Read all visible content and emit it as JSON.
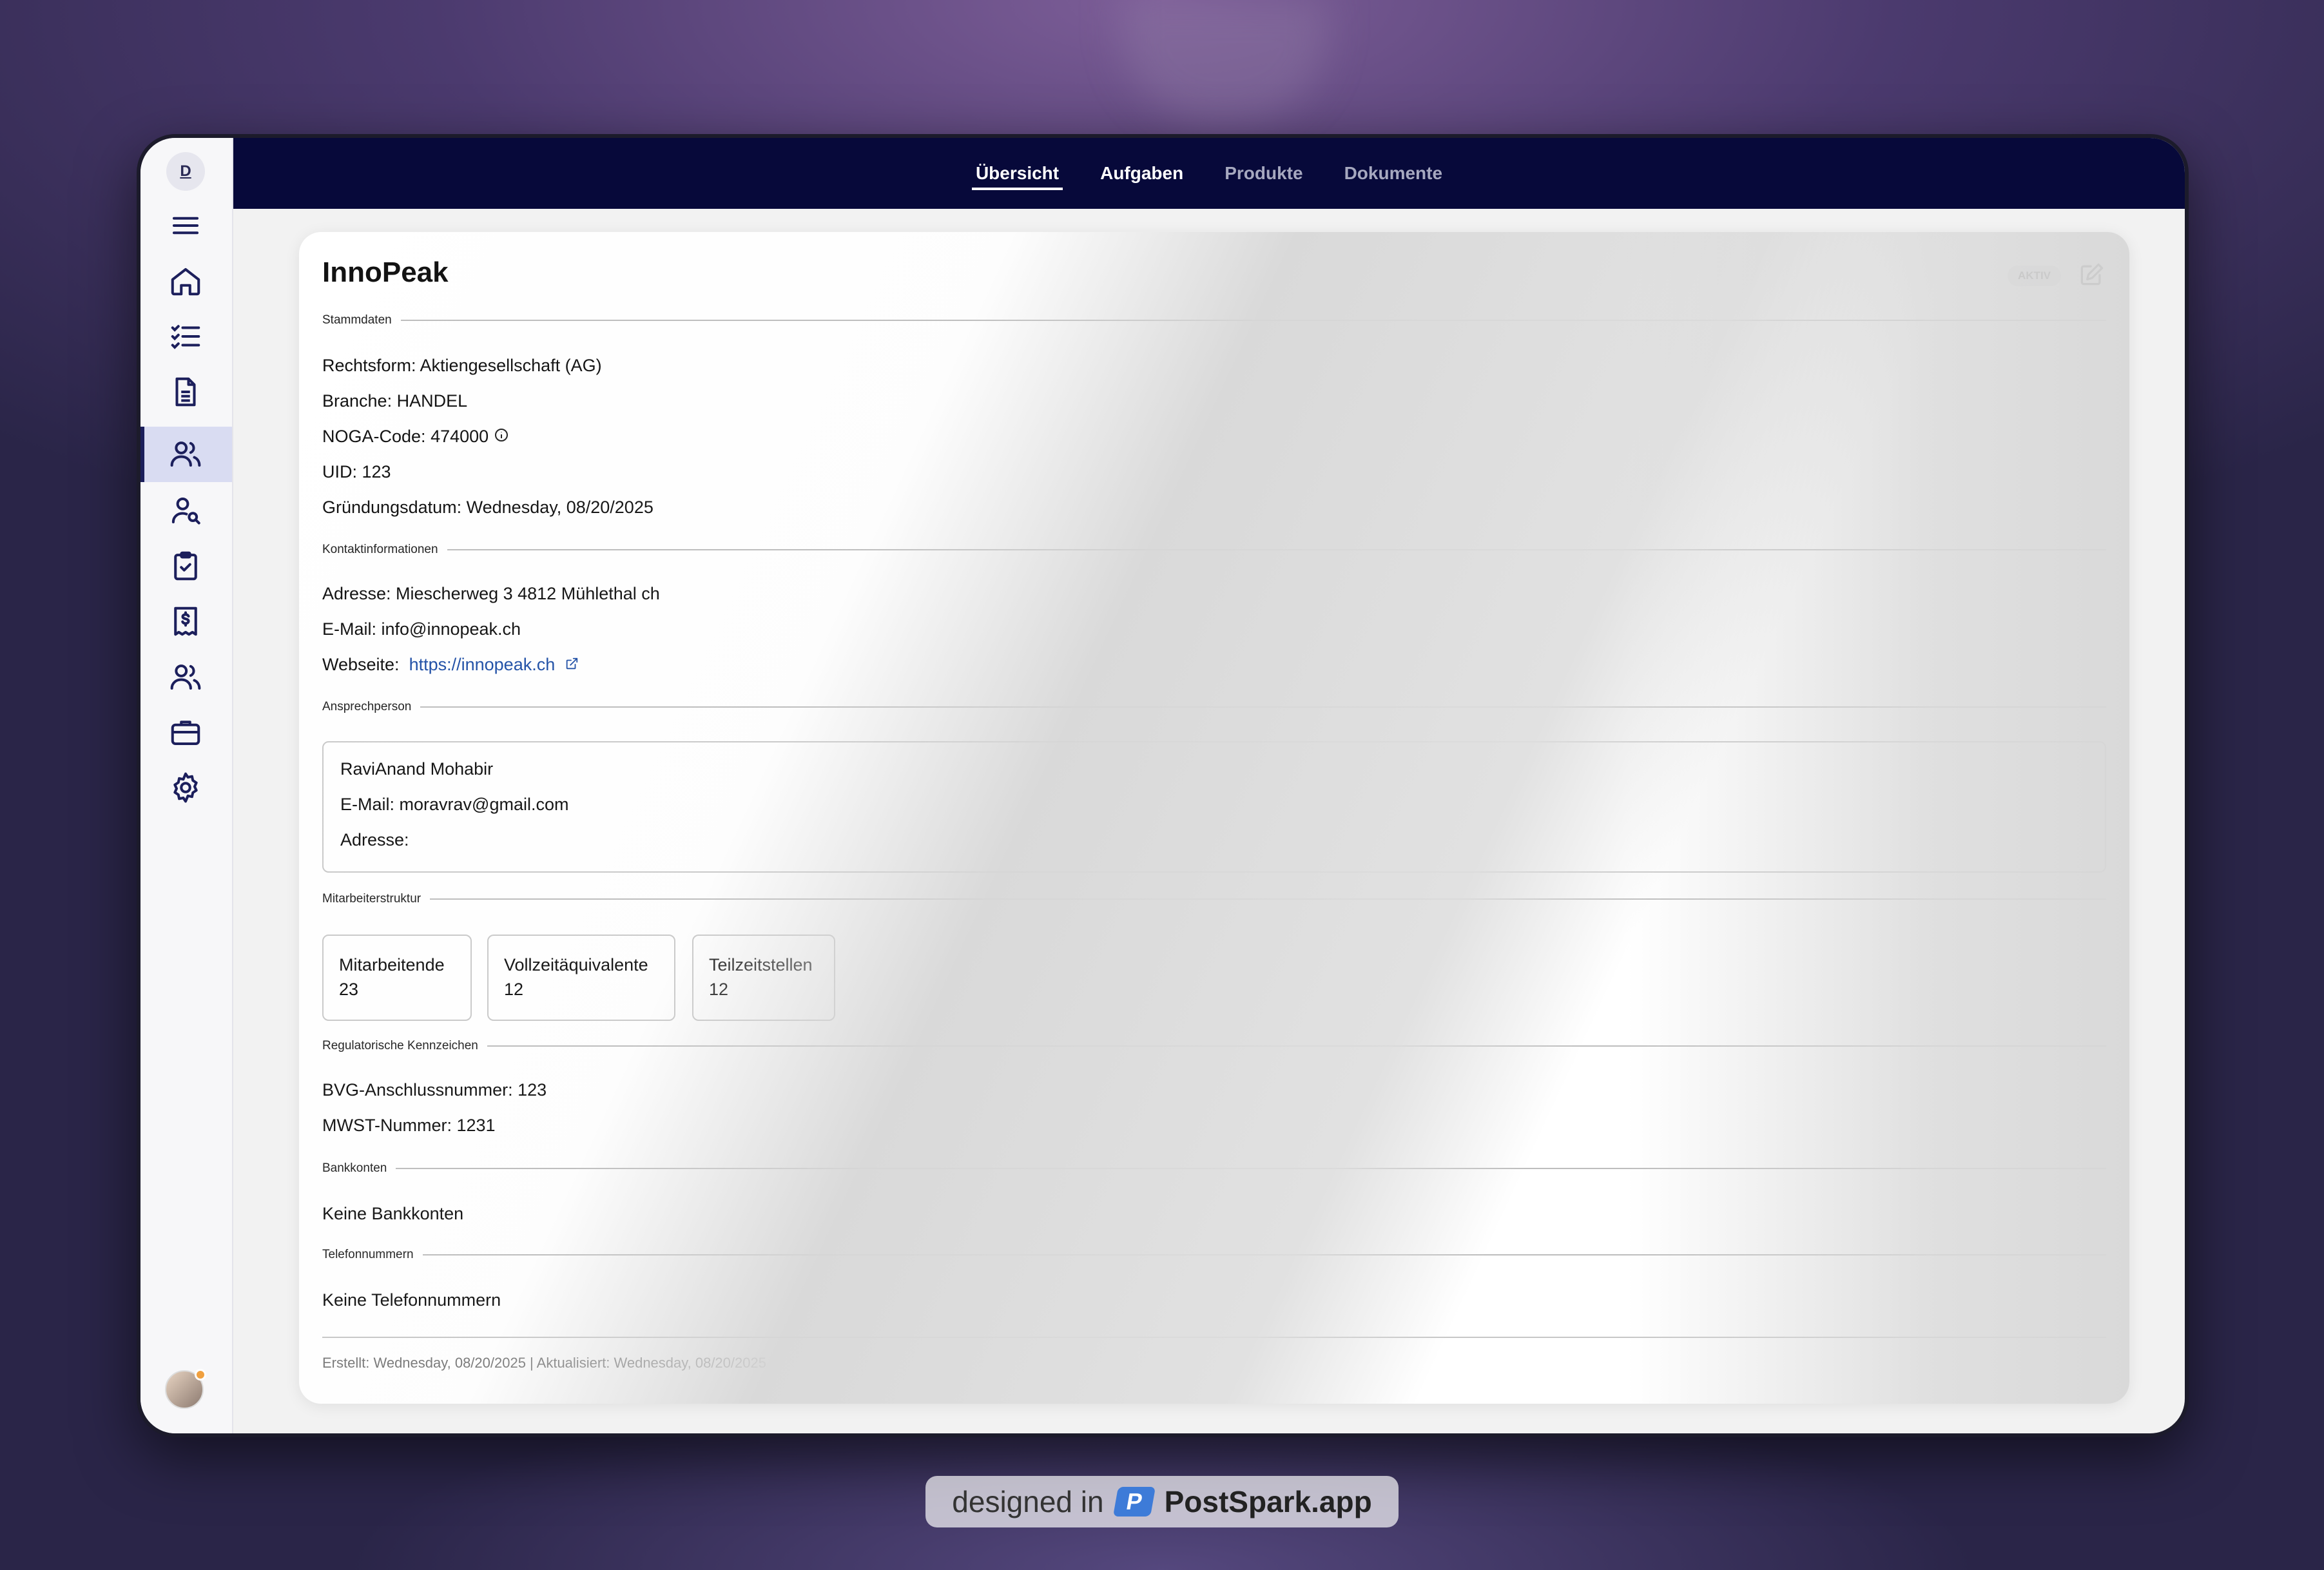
{
  "app": {
    "logo_letter": "D"
  },
  "tabs": [
    {
      "label": "Übersicht"
    },
    {
      "label": "Aufgaben"
    },
    {
      "label": "Produkte"
    },
    {
      "label": "Dokumente"
    }
  ],
  "sidebar": {
    "icons": [
      "menu-icon",
      "home-icon",
      "checklist-icon",
      "document-icon",
      "users-icon",
      "user-search-icon",
      "clipboard-check-icon",
      "invoice-icon",
      "team-icon",
      "briefcase-icon",
      "settings-icon"
    ]
  },
  "company": {
    "name": "InnoPeak",
    "status": "AKTIV"
  },
  "stammdaten": {
    "heading": "Stammdaten",
    "rechtsform": "Rechtsform: Aktiengesellschaft (AG)",
    "branche": "Branche: HANDEL",
    "noga_label": "NOGA-Code:",
    "noga_value": "474000",
    "uid": "UID: 123",
    "gruendung": "Gründungsdatum: Wednesday, 08/20/2025"
  },
  "kontakt": {
    "heading": "Kontaktinformationen",
    "adresse": "Adresse: Miescherweg 3 4812 Mühlethal ch",
    "email": "E-Mail: info@innopeak.ch",
    "website_label": "Webseite:",
    "website_url": "https://innopeak.ch"
  },
  "ansprechperson": {
    "heading": "Ansprechperson",
    "name": "RaviAnand Mohabir",
    "email": "E-Mail: moravrav@gmail.com",
    "adresse": "Adresse:"
  },
  "mitarbeiter": {
    "heading": "Mitarbeiterstruktur",
    "stats": [
      {
        "label": "Mitarbeitende",
        "value": "23"
      },
      {
        "label": "Vollzeitäquivalente",
        "value": "12"
      },
      {
        "label": "Teilzeitstellen",
        "value": "12"
      }
    ]
  },
  "regulatorisch": {
    "heading": "Regulatorische Kennzeichen",
    "bvg": "BVG-Anschlussnummer: 123",
    "mwst": "MWST-Nummer: 1231"
  },
  "bankkonten": {
    "heading": "Bankkonten",
    "empty": "Keine Bankkonten"
  },
  "telefon": {
    "heading": "Telefonnummern",
    "empty": "Keine Telefonnummern"
  },
  "footer": {
    "text": "Erstellt: Wednesday, 08/20/2025 | Aktualisiert: Wednesday, 08/20/2025"
  },
  "watermark": {
    "prefix": "designed in",
    "logo_letter": "P",
    "brand": "PostSpark.app"
  },
  "colors": {
    "topbar": "#07093a",
    "accent": "#1c1f5c",
    "link": "#1f4fa6"
  }
}
